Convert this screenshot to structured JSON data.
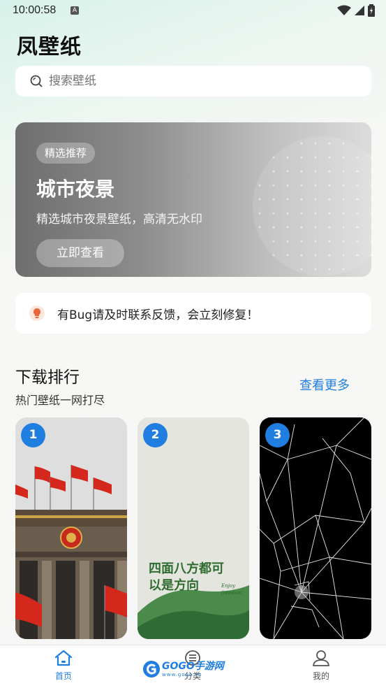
{
  "status_bar": {
    "time": "10:00:58",
    "indicator": "A"
  },
  "app": {
    "title": "凤壁纸"
  },
  "search": {
    "placeholder": "搜索壁纸"
  },
  "banner": {
    "badge": "精选推荐",
    "title": "城市夜景",
    "subtitle": "精选城市夜景壁纸，高清无水印",
    "button": "立即查看"
  },
  "notice": {
    "text": "有Bug请及时联系反馈，会立刻修复！"
  },
  "section": {
    "title": "下载排行",
    "subtitle": "热门壁纸一网打尽",
    "more": "查看更多"
  },
  "cards": [
    {
      "rank": "1"
    },
    {
      "rank": "2",
      "art_text": "四面八方都可以是方向",
      "art_small": "Enjoy freedom"
    },
    {
      "rank": "3"
    }
  ],
  "bottom_nav": {
    "home": "首页",
    "category": "分类",
    "me": "我的"
  },
  "watermark": {
    "brand": "GOGO手游网",
    "url": "www.gogo.cn"
  },
  "colors": {
    "accent": "#1f7ee0",
    "notice_icon": "#e8643c"
  }
}
